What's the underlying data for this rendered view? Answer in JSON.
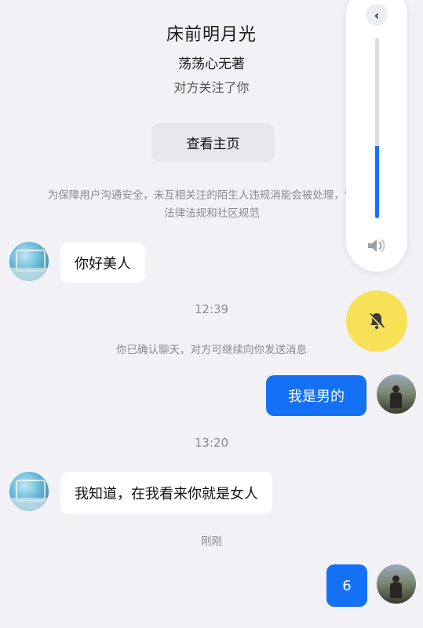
{
  "header": {
    "contact_name": "床前明月光",
    "subtitle": "荡荡心无著",
    "follow_status": "对方关注了你",
    "view_profile_label": "查看主页"
  },
  "notice": "为保障用户沟通安全，未互相关注的陌生人违规消能会被处理，请遵守法律法规和社区规范",
  "messages": {
    "m1": "你好美人",
    "time1": "12:39",
    "sys1": "你已确认聊天，对方可继续向你发送消息",
    "m2": "我是男的",
    "time2": "13:20",
    "m3": "我知道，在我看来你就是女人",
    "time3": "刚刚",
    "m4": "6"
  },
  "volume_overlay": {
    "level": 0.4,
    "back_icon": "chevron-left-icon",
    "speaker_icon": "speaker-icon",
    "mute_icon": "bell-off-icon",
    "accent": "#1470f5",
    "mute_color": "#f7e157"
  }
}
